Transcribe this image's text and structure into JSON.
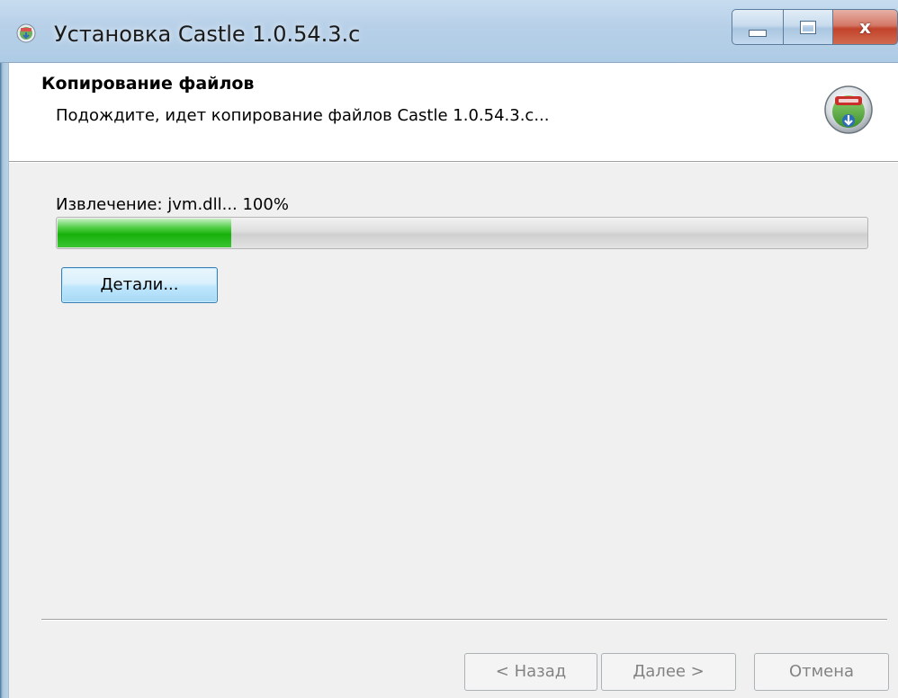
{
  "window": {
    "title": "Установка Castle 1.0.54.3.c",
    "close_glyph": "x"
  },
  "header": {
    "title": "Копирование файлов",
    "subtitle": "Подождите, идет копирование файлов Castle 1.0.54.3.c...",
    "icon": "installer-disc-icon"
  },
  "progress": {
    "status_text": "Извлечение: jvm.dll... 100%",
    "fraction": 0.215
  },
  "buttons": {
    "details": "Детали...",
    "back": "< Назад",
    "next": "Далее >",
    "cancel": "Отмена"
  },
  "colors": {
    "progress_fill": "#17b10b",
    "disabled_text": "#838383"
  }
}
